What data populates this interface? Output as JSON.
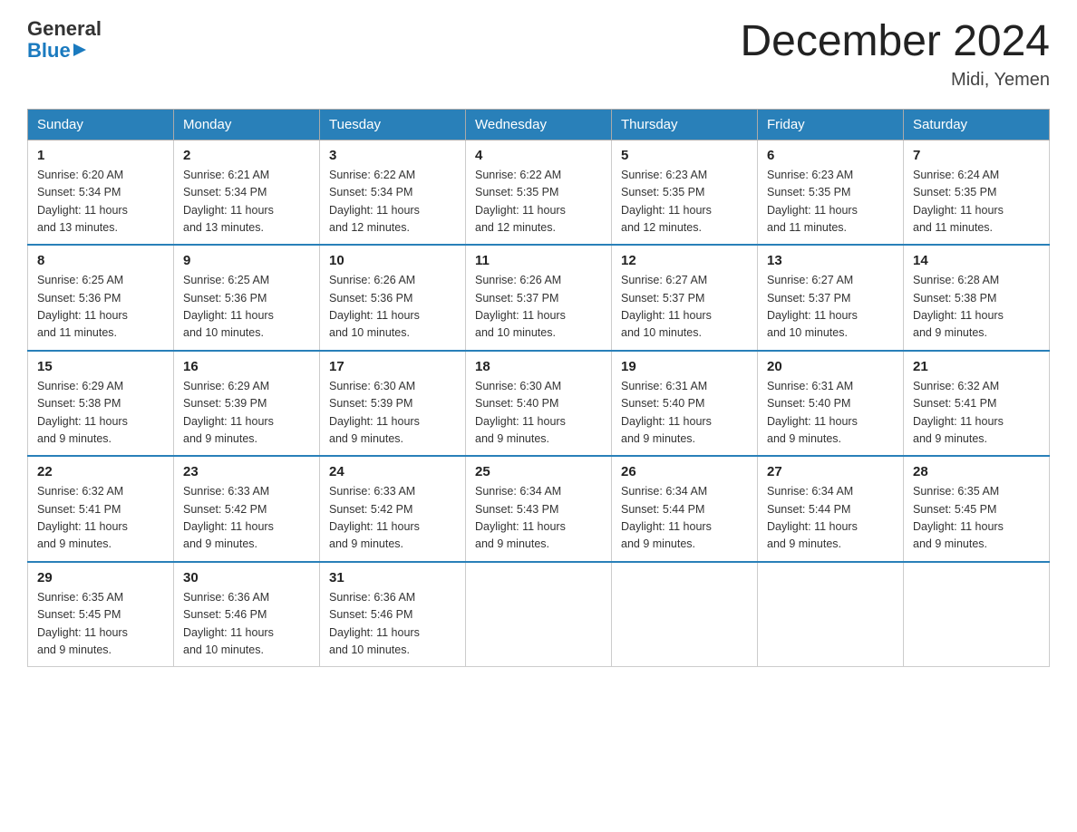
{
  "logo": {
    "general": "General",
    "blue": "Blue"
  },
  "title": "December 2024",
  "location": "Midi, Yemen",
  "days_of_week": [
    "Sunday",
    "Monday",
    "Tuesday",
    "Wednesday",
    "Thursday",
    "Friday",
    "Saturday"
  ],
  "weeks": [
    [
      {
        "day": "1",
        "sunrise": "6:20 AM",
        "sunset": "5:34 PM",
        "daylight": "11 hours and 13 minutes."
      },
      {
        "day": "2",
        "sunrise": "6:21 AM",
        "sunset": "5:34 PM",
        "daylight": "11 hours and 13 minutes."
      },
      {
        "day": "3",
        "sunrise": "6:22 AM",
        "sunset": "5:34 PM",
        "daylight": "11 hours and 12 minutes."
      },
      {
        "day": "4",
        "sunrise": "6:22 AM",
        "sunset": "5:35 PM",
        "daylight": "11 hours and 12 minutes."
      },
      {
        "day": "5",
        "sunrise": "6:23 AM",
        "sunset": "5:35 PM",
        "daylight": "11 hours and 12 minutes."
      },
      {
        "day": "6",
        "sunrise": "6:23 AM",
        "sunset": "5:35 PM",
        "daylight": "11 hours and 11 minutes."
      },
      {
        "day": "7",
        "sunrise": "6:24 AM",
        "sunset": "5:35 PM",
        "daylight": "11 hours and 11 minutes."
      }
    ],
    [
      {
        "day": "8",
        "sunrise": "6:25 AM",
        "sunset": "5:36 PM",
        "daylight": "11 hours and 11 minutes."
      },
      {
        "day": "9",
        "sunrise": "6:25 AM",
        "sunset": "5:36 PM",
        "daylight": "11 hours and 10 minutes."
      },
      {
        "day": "10",
        "sunrise": "6:26 AM",
        "sunset": "5:36 PM",
        "daylight": "11 hours and 10 minutes."
      },
      {
        "day": "11",
        "sunrise": "6:26 AM",
        "sunset": "5:37 PM",
        "daylight": "11 hours and 10 minutes."
      },
      {
        "day": "12",
        "sunrise": "6:27 AM",
        "sunset": "5:37 PM",
        "daylight": "11 hours and 10 minutes."
      },
      {
        "day": "13",
        "sunrise": "6:27 AM",
        "sunset": "5:37 PM",
        "daylight": "11 hours and 10 minutes."
      },
      {
        "day": "14",
        "sunrise": "6:28 AM",
        "sunset": "5:38 PM",
        "daylight": "11 hours and 9 minutes."
      }
    ],
    [
      {
        "day": "15",
        "sunrise": "6:29 AM",
        "sunset": "5:38 PM",
        "daylight": "11 hours and 9 minutes."
      },
      {
        "day": "16",
        "sunrise": "6:29 AM",
        "sunset": "5:39 PM",
        "daylight": "11 hours and 9 minutes."
      },
      {
        "day": "17",
        "sunrise": "6:30 AM",
        "sunset": "5:39 PM",
        "daylight": "11 hours and 9 minutes."
      },
      {
        "day": "18",
        "sunrise": "6:30 AM",
        "sunset": "5:40 PM",
        "daylight": "11 hours and 9 minutes."
      },
      {
        "day": "19",
        "sunrise": "6:31 AM",
        "sunset": "5:40 PM",
        "daylight": "11 hours and 9 minutes."
      },
      {
        "day": "20",
        "sunrise": "6:31 AM",
        "sunset": "5:40 PM",
        "daylight": "11 hours and 9 minutes."
      },
      {
        "day": "21",
        "sunrise": "6:32 AM",
        "sunset": "5:41 PM",
        "daylight": "11 hours and 9 minutes."
      }
    ],
    [
      {
        "day": "22",
        "sunrise": "6:32 AM",
        "sunset": "5:41 PM",
        "daylight": "11 hours and 9 minutes."
      },
      {
        "day": "23",
        "sunrise": "6:33 AM",
        "sunset": "5:42 PM",
        "daylight": "11 hours and 9 minutes."
      },
      {
        "day": "24",
        "sunrise": "6:33 AM",
        "sunset": "5:42 PM",
        "daylight": "11 hours and 9 minutes."
      },
      {
        "day": "25",
        "sunrise": "6:34 AM",
        "sunset": "5:43 PM",
        "daylight": "11 hours and 9 minutes."
      },
      {
        "day": "26",
        "sunrise": "6:34 AM",
        "sunset": "5:44 PM",
        "daylight": "11 hours and 9 minutes."
      },
      {
        "day": "27",
        "sunrise": "6:34 AM",
        "sunset": "5:44 PM",
        "daylight": "11 hours and 9 minutes."
      },
      {
        "day": "28",
        "sunrise": "6:35 AM",
        "sunset": "5:45 PM",
        "daylight": "11 hours and 9 minutes."
      }
    ],
    [
      {
        "day": "29",
        "sunrise": "6:35 AM",
        "sunset": "5:45 PM",
        "daylight": "11 hours and 9 minutes."
      },
      {
        "day": "30",
        "sunrise": "6:36 AM",
        "sunset": "5:46 PM",
        "daylight": "11 hours and 10 minutes."
      },
      {
        "day": "31",
        "sunrise": "6:36 AM",
        "sunset": "5:46 PM",
        "daylight": "11 hours and 10 minutes."
      },
      null,
      null,
      null,
      null
    ]
  ],
  "labels": {
    "sunrise": "Sunrise:",
    "sunset": "Sunset:",
    "daylight": "Daylight:"
  }
}
